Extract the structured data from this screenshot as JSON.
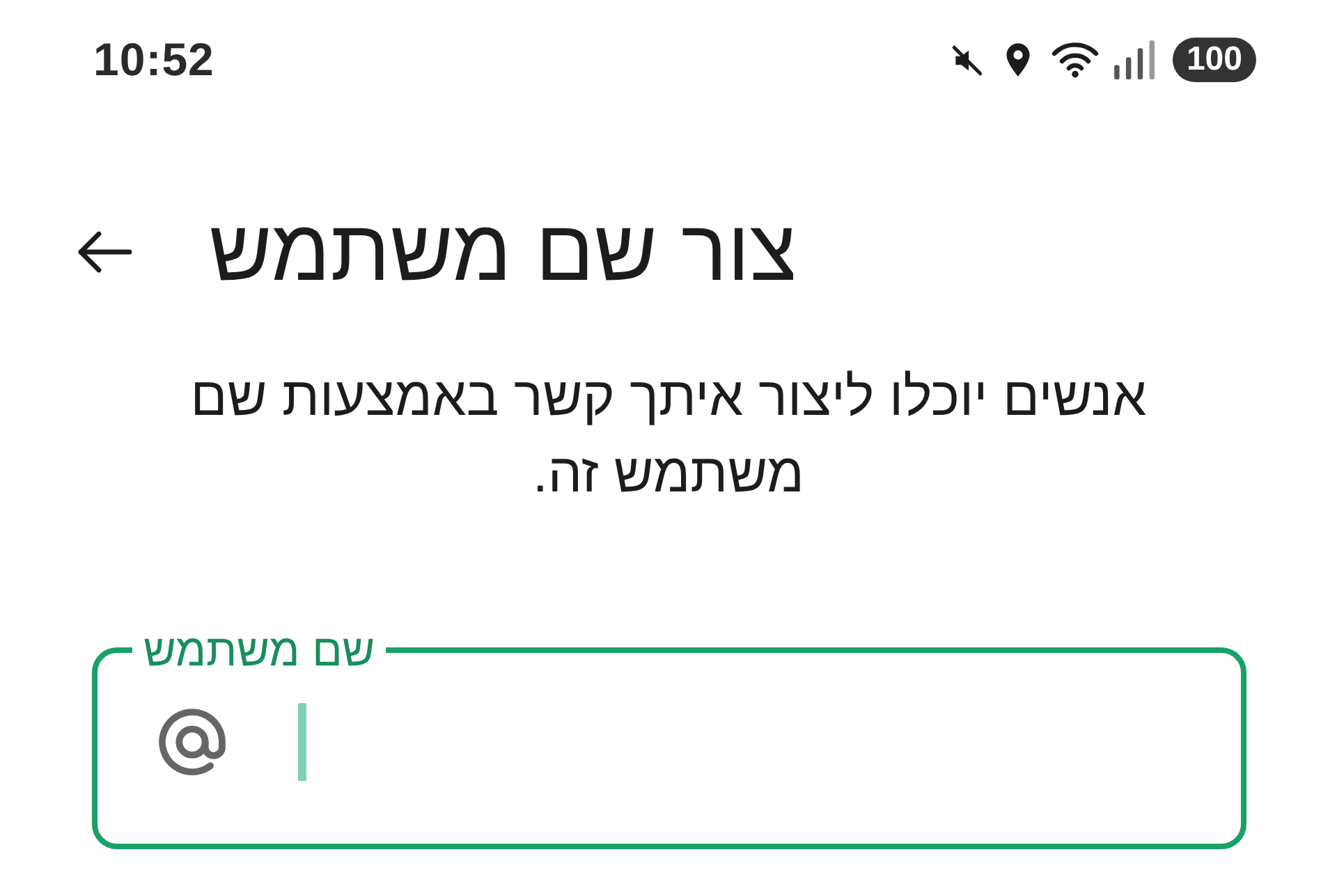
{
  "status_bar": {
    "time": "10:52",
    "battery": "100"
  },
  "header": {
    "title": "צור שם משתמש"
  },
  "description": "אנשים יוכלו ליצור איתך קשר באמצעות שם משתמש זה.",
  "username_field": {
    "label": "שם משתמש",
    "focused": true
  }
}
